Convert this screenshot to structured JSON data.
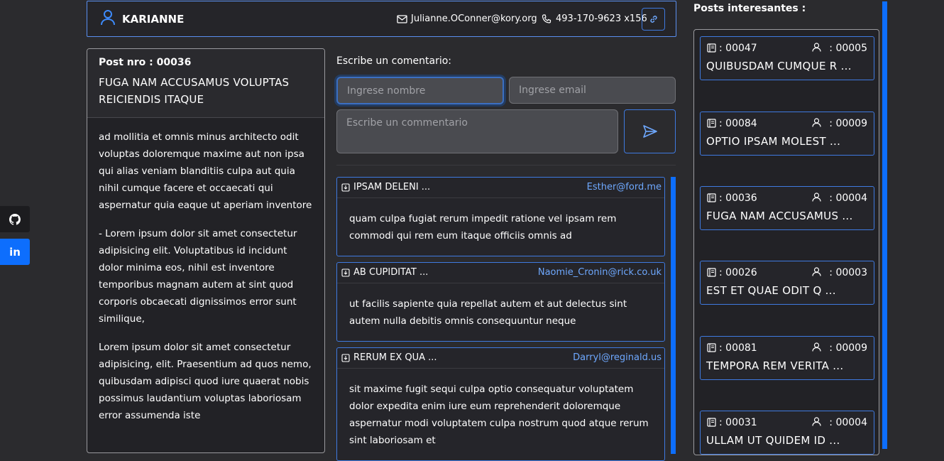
{
  "social": {
    "github_icon": "github-icon",
    "linkedin_label": "in"
  },
  "header": {
    "username": "KARIANNE",
    "email": "Julianne.OConner@kory.org",
    "phone": "493-170-9623 x156"
  },
  "post": {
    "number": "Post nro : 00036",
    "title": "FUGA NAM ACCUSAMUS VOLUPTAS REICIENDIS ITAQUE",
    "paragraphs": [
      "ad mollitia et omnis minus architecto odit voluptas doloremque maxime aut non ipsa qui alias veniam blanditiis culpa aut quia nihil cumque facere et occaecati qui aspernatur quia eaque ut aperiam inventore",
      "- Lorem ipsum dolor sit amet consectetur adipisicing elit. Voluptatibus id incidunt dolor minima eos, nihil est inventore temporibus magnam autem at sint quod corporis obcaecati dignissimos error sunt similique,",
      "Lorem ipsum dolor sit amet consectetur adipisicing, elit. Praesentium ad quos nemo, quibusdam adipisci quod iure quaerat nobis possimus laudantium voluptas laboriosam error assumenda iste"
    ]
  },
  "form": {
    "label": "Escribe un comentario:",
    "name_placeholder": "Ingrese nombre",
    "email_placeholder": "Ingrese email",
    "comment_placeholder": "Escribe un commentario"
  },
  "comments": [
    {
      "title": "IPSAM DELENI ...",
      "email": "Esther@ford.me",
      "text": "quam culpa fugiat rerum impedit ratione vel ipsam rem commodi qui rem eum itaque officiis omnis ad"
    },
    {
      "title": "AB CUPIDITAT ...",
      "email": "Naomie_Cronin@rick.co.uk",
      "text": "ut facilis sapiente quia repellat autem et aut delectus sint autem nulla debitis omnis consequuntur neque"
    },
    {
      "title": "RERUM EX QUA ...",
      "email": "Darryl@reginald.us",
      "text": "sit maxime fugit sequi culpa optio consequatur voluptatem dolor expedita enim iure eum reprehenderit doloremque aspernatur modi voluptatem culpa nostrum quod atque rerum sint laboriosam et"
    }
  ],
  "sidebar": {
    "title": "Posts interesantes :",
    "posts": [
      {
        "number": ": 00047",
        "user": ": 00005",
        "title": "QUIBUSDAM CUMQUE R ..."
      },
      {
        "number": ": 00084",
        "user": ": 00009",
        "title": "OPTIO IPSAM MOLEST ..."
      },
      {
        "number": ": 00036",
        "user": ": 00004",
        "title": "FUGA NAM ACCUSAMUS ..."
      },
      {
        "number": ": 00026",
        "user": ": 00003",
        "title": "EST ET QUAE ODIT Q ..."
      },
      {
        "number": ": 00081",
        "user": ": 00009",
        "title": "TEMPORA REM VERITA ..."
      },
      {
        "number": ": 00031",
        "user": ": 00004",
        "title": "ULLAM UT QUIDEM ID ..."
      }
    ]
  },
  "colors": {
    "accent": "#0d6efd",
    "background": "#2b2b2e",
    "email_link": "#6ea8fe"
  }
}
